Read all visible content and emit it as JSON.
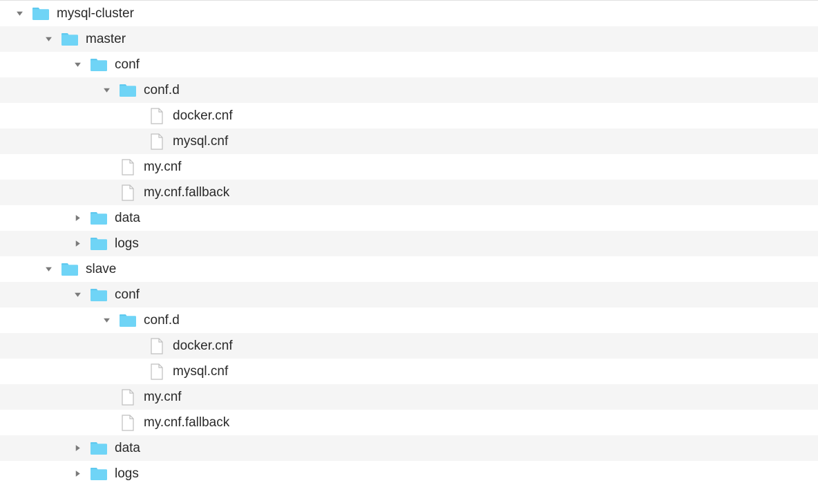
{
  "rows": [
    {
      "label": "mysql-cluster",
      "type": "folder",
      "indent": 0,
      "disclosure": "down",
      "alt": false
    },
    {
      "label": "master",
      "type": "folder",
      "indent": 1,
      "disclosure": "down",
      "alt": true
    },
    {
      "label": "conf",
      "type": "folder",
      "indent": 2,
      "disclosure": "down",
      "alt": false
    },
    {
      "label": "conf.d",
      "type": "folder",
      "indent": 3,
      "disclosure": "down",
      "alt": true
    },
    {
      "label": "docker.cnf",
      "type": "file",
      "indent": 4,
      "disclosure": "none",
      "alt": false
    },
    {
      "label": "mysql.cnf",
      "type": "file",
      "indent": 4,
      "disclosure": "none",
      "alt": true
    },
    {
      "label": "my.cnf",
      "type": "file",
      "indent": 3,
      "disclosure": "none",
      "alt": false
    },
    {
      "label": "my.cnf.fallback",
      "type": "file",
      "indent": 3,
      "disclosure": "none",
      "alt": true
    },
    {
      "label": "data",
      "type": "folder",
      "indent": 2,
      "disclosure": "right",
      "alt": false
    },
    {
      "label": "logs",
      "type": "folder",
      "indent": 2,
      "disclosure": "right",
      "alt": true
    },
    {
      "label": "slave",
      "type": "folder",
      "indent": 1,
      "disclosure": "down",
      "alt": false
    },
    {
      "label": "conf",
      "type": "folder",
      "indent": 2,
      "disclosure": "down",
      "alt": true
    },
    {
      "label": "conf.d",
      "type": "folder",
      "indent": 3,
      "disclosure": "down",
      "alt": false
    },
    {
      "label": "docker.cnf",
      "type": "file",
      "indent": 4,
      "disclosure": "none",
      "alt": true
    },
    {
      "label": "mysql.cnf",
      "type": "file",
      "indent": 4,
      "disclosure": "none",
      "alt": false
    },
    {
      "label": "my.cnf",
      "type": "file",
      "indent": 3,
      "disclosure": "none",
      "alt": true
    },
    {
      "label": "my.cnf.fallback",
      "type": "file",
      "indent": 3,
      "disclosure": "none",
      "alt": false
    },
    {
      "label": "data",
      "type": "folder",
      "indent": 2,
      "disclosure": "right",
      "alt": true
    },
    {
      "label": "logs",
      "type": "folder",
      "indent": 2,
      "disclosure": "right",
      "alt": false
    }
  ],
  "colors": {
    "folder_fill": "#6fd4f6",
    "folder_tab": "#5fc9ef",
    "file_fill": "#ffffff",
    "file_stroke": "#bfbfbf"
  }
}
